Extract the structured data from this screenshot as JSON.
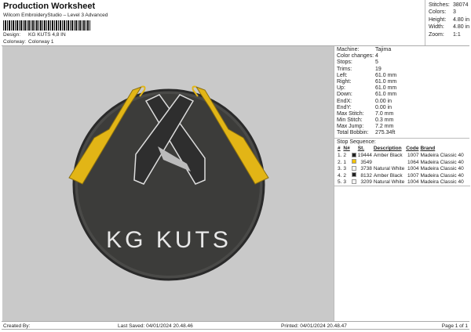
{
  "header": {
    "title": "Production Worksheet",
    "subtitle": "Wilcom EmbroideryStudio – Level 3 Advanced",
    "design_label": "Design:",
    "design_value": "KG KUTS 4,8 IN",
    "colorway_label": "Colorway:",
    "colorway_value": "Colorway 1"
  },
  "stats": [
    {
      "k": "Stitches:",
      "v": "38074"
    },
    {
      "k": "Colors:",
      "v": "3"
    },
    {
      "k": "Height:",
      "v": "4.80 in"
    },
    {
      "k": "Width:",
      "v": "4.80 in"
    },
    {
      "k": "Zoom:",
      "v": "1:1"
    }
  ],
  "machine": [
    {
      "k": "Machine:",
      "v": "Tajima"
    },
    {
      "k": "Color changes:",
      "v": "4"
    },
    {
      "k": "Stops:",
      "v": "5"
    },
    {
      "k": "Trims:",
      "v": "19"
    },
    {
      "k": "Left:",
      "v": "61.0 mm"
    },
    {
      "k": "Right:",
      "v": "61.0 mm"
    },
    {
      "k": "Up:",
      "v": "61.0 mm"
    },
    {
      "k": "Down:",
      "v": "61.0 mm"
    },
    {
      "k": "EndX:",
      "v": "0.00 in"
    },
    {
      "k": "EndY:",
      "v": "0.00 in"
    },
    {
      "k": "Max Stitch:",
      "v": "7.0 mm"
    },
    {
      "k": "Min Stitch:",
      "v": "0.3 mm"
    },
    {
      "k": "Max Jump:",
      "v": "7.2 mm"
    },
    {
      "k": "Total Bobbin:",
      "v": "275.34ft"
    }
  ],
  "stop_sequence": {
    "title": "Stop Sequence:",
    "headers": [
      "#",
      "N#",
      "St.",
      "Description",
      "Code",
      "Brand"
    ],
    "rows": [
      {
        "n": "1.",
        "nn": "2",
        "color": "#222222",
        "st": "19444",
        "desc": "Amber Black",
        "code": "1007",
        "brand": "Madeira Classic 40"
      },
      {
        "n": "2.",
        "nn": "1",
        "color": "#f2c200",
        "st": "3549",
        "desc": "",
        "code": "1064",
        "brand": "Madeira Classic 40"
      },
      {
        "n": "3.",
        "nn": "3",
        "color": "#f4f4f4",
        "st": "3738",
        "desc": "Natural White",
        "code": "1004",
        "brand": "Madeira Classic 40"
      },
      {
        "n": "4.",
        "nn": "2",
        "color": "#222222",
        "st": "8132",
        "desc": "Amber Black",
        "code": "1007",
        "brand": "Madeira Classic 40"
      },
      {
        "n": "5.",
        "nn": "3",
        "color": "#f4f4f4",
        "st": "3209",
        "desc": "Natural White",
        "code": "1004",
        "brand": "Madeira Classic 40"
      }
    ]
  },
  "design": {
    "text": "KG KUTS",
    "colors": {
      "black": "#3a3a38",
      "yellow": "#e6b814",
      "white": "#e8e8e8"
    }
  },
  "footer": {
    "created": "Created By:",
    "saved": "Last Saved: 04/01/2024 20.48.46",
    "printed": "Printed: 04/01/2024 20.48.47",
    "page": "Page 1 of 1"
  }
}
